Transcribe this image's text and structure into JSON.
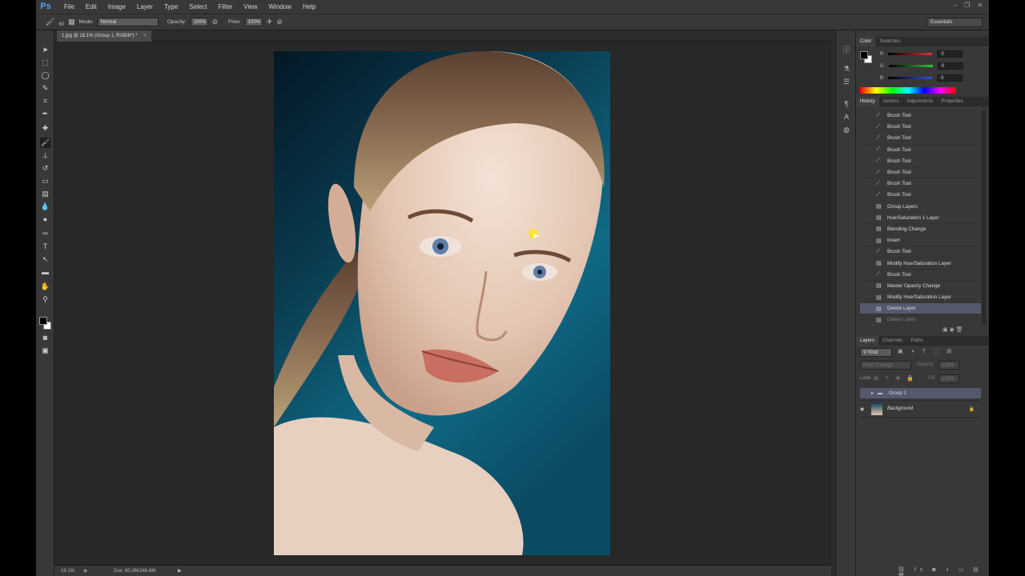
{
  "app": {
    "logo": "Ps",
    "menu": [
      "File",
      "Edit",
      "Image",
      "Layer",
      "Type",
      "Select",
      "Filter",
      "View",
      "Window",
      "Help"
    ],
    "window_controls": [
      "–",
      "❐",
      "✕"
    ]
  },
  "options": {
    "brush_size": "60",
    "mode_label": "Mode:",
    "mode_value": "Normal",
    "opacity_label": "Opacity:",
    "opacity_value": "100%",
    "flow_label": "Flow:",
    "flow_value": "100%",
    "workspace": "Essentials"
  },
  "document": {
    "tab_title": "1.jpg @ 18.1% (Group 1, RGB/8*) *",
    "close": "×"
  },
  "status": {
    "zoom": "18.1%",
    "doc": "Doc: 60.2M/246.6M"
  },
  "color_panel": {
    "tabs": [
      "Color",
      "Swatches"
    ],
    "channels": [
      {
        "label": "R",
        "value": "0",
        "color": "#e03030"
      },
      {
        "label": "G",
        "value": "0",
        "color": "#30c040"
      },
      {
        "label": "B",
        "value": "0",
        "color": "#3050e0"
      }
    ]
  },
  "history_panel": {
    "tabs": [
      "History",
      "Actions",
      "Adjustments",
      "Properties"
    ],
    "items": [
      {
        "label": "Brush Tool",
        "icon": "brush-icon"
      },
      {
        "label": "Brush Tool",
        "icon": "brush-icon"
      },
      {
        "label": "Brush Tool",
        "icon": "brush-icon"
      },
      {
        "label": "Brush Tool",
        "icon": "brush-icon"
      },
      {
        "label": "Brush Tool",
        "icon": "brush-icon"
      },
      {
        "label": "Brush Tool",
        "icon": "brush-icon"
      },
      {
        "label": "Brush Tool",
        "icon": "brush-icon"
      },
      {
        "label": "Brush Tool",
        "icon": "brush-icon"
      },
      {
        "label": "Group Layers",
        "icon": "document-icon"
      },
      {
        "label": "Hue/Saturation 1 Layer",
        "icon": "document-icon"
      },
      {
        "label": "Blending Change",
        "icon": "document-icon"
      },
      {
        "label": "Invert",
        "icon": "document-icon"
      },
      {
        "label": "Brush Tool",
        "icon": "brush-icon"
      },
      {
        "label": "Modify Hue/Saturation Layer",
        "icon": "document-icon"
      },
      {
        "label": "Brush Tool",
        "icon": "brush-icon"
      },
      {
        "label": "Master Opacity Change",
        "icon": "document-icon"
      },
      {
        "label": "Modify Hue/Saturation Layer",
        "icon": "document-icon"
      },
      {
        "label": "Delete Layer",
        "icon": "document-icon",
        "selected": true
      },
      {
        "label": "Delete Layer",
        "icon": "document-icon",
        "dimmed": true
      }
    ]
  },
  "layers_panel": {
    "tabs": [
      "Layers",
      "Channels",
      "Paths"
    ],
    "filter": "Kind",
    "blend": "Pass Through",
    "opacity_label": "Opacity:",
    "opacity_value": "100%",
    "lock_label": "Lock:",
    "fill_label": "Fill:",
    "fill_value": "100%",
    "layers": [
      {
        "name": "Group 1"
      },
      {
        "name": "Background"
      }
    ]
  }
}
